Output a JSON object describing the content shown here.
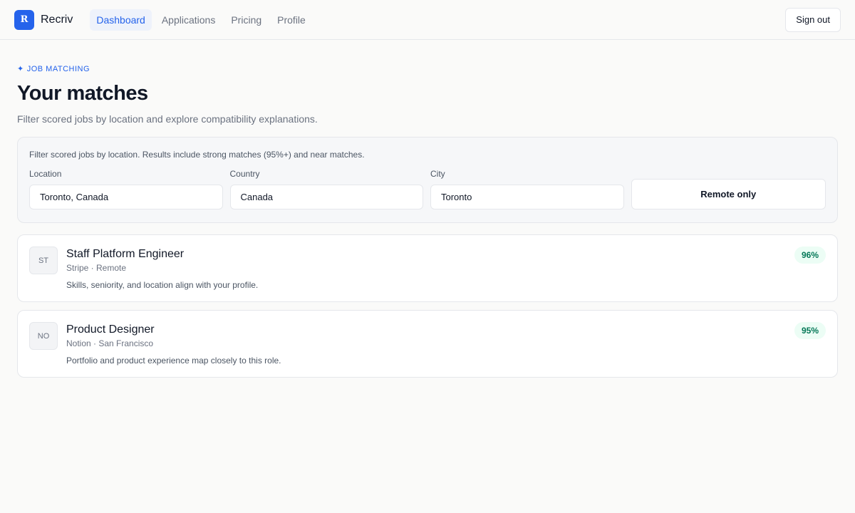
{
  "app": {
    "logo_letter": "R",
    "name": "Recriv"
  },
  "nav": {
    "items": [
      {
        "label": "Dashboard",
        "active": true
      },
      {
        "label": "Applications",
        "active": false
      },
      {
        "label": "Pricing",
        "active": false
      },
      {
        "label": "Profile",
        "active": false
      }
    ],
    "signout_label": "Sign out"
  },
  "header": {
    "eyebrow_icon": "sparkle-icon",
    "eyebrow_glyph": "✦",
    "eyebrow": "JOB MATCHING",
    "title": "Your matches",
    "subtitle": "Filter scored jobs by location and explore compatibility explanations."
  },
  "filters": {
    "note": "Filter scored jobs by location. Results include strong matches (95%+) and near matches.",
    "location": {
      "label": "Location",
      "value": "Toronto, Canada"
    },
    "country": {
      "label": "Country",
      "value": "Canada"
    },
    "city": {
      "label": "City",
      "value": "Toronto"
    },
    "remote_label": "Remote only"
  },
  "jobs": [
    {
      "initials": "ST",
      "title": "Staff Platform Engineer",
      "meta": "Stripe · Remote",
      "description": "Skills, seniority, and location align with your profile.",
      "score": "96%"
    },
    {
      "initials": "NO",
      "title": "Product Designer",
      "meta": "Notion · San Francisco",
      "description": "Portfolio and product experience map closely to this role.",
      "score": "95%"
    }
  ],
  "colors": {
    "accent": "#2563eb",
    "score_bg": "#ecfdf5",
    "score_text": "#047857"
  }
}
